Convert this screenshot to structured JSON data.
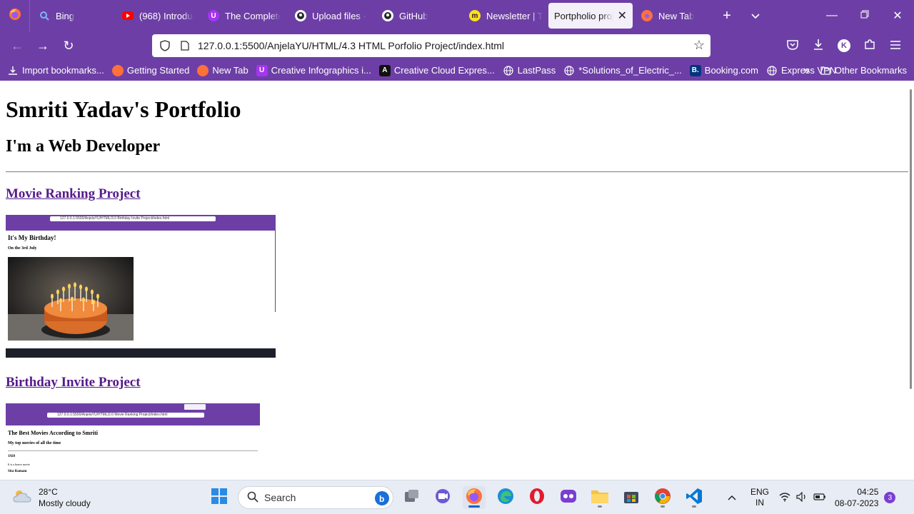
{
  "browser": {
    "tabs": [
      {
        "title": "Bing",
        "icon": "search-icon",
        "color": "#2f7cf6"
      },
      {
        "title": "(968) Introducti",
        "icon": "youtube-icon",
        "color": "#ff0000"
      },
      {
        "title": "The Complete",
        "icon": "udemy-icon",
        "color": "#a435f0"
      },
      {
        "title": "Upload files · S",
        "icon": "github-icon",
        "color": "#24292f"
      },
      {
        "title": "GitHub",
        "icon": "github-icon",
        "color": "#24292f"
      },
      {
        "title": "Newsletter | Th",
        "icon": "chimp-icon",
        "color": "#ffe01b"
      },
      {
        "title": "Portpholio proje",
        "icon": "none",
        "color": "#ffffff"
      },
      {
        "title": "New Tab",
        "icon": "firefox-icon",
        "color": "#ff7139"
      }
    ],
    "active_tab_index": 6,
    "url": "127.0.0.1:5500/AnjelaYU/HTML/4.3 HTML Porfolio Project/index.html",
    "account_initial": "K",
    "bookmarks": [
      {
        "label": "Import bookmarks...",
        "icon": "import-icon"
      },
      {
        "label": "Getting Started",
        "icon": "firefox-icon"
      },
      {
        "label": "New Tab",
        "icon": "firefox-icon"
      },
      {
        "label": "Creative Infographics i...",
        "icon": "udemy-icon"
      },
      {
        "label": "Creative Cloud Expres...",
        "icon": "adobe-icon"
      },
      {
        "label": "LastPass",
        "icon": "globe-icon"
      },
      {
        "label": "*Solutions_of_Electric_...",
        "icon": "globe-icon"
      },
      {
        "label": "Booking.com",
        "icon": "booking-icon"
      },
      {
        "label": "Express VPN",
        "icon": "globe-icon"
      }
    ],
    "other_bookmarks": "Other Bookmarks"
  },
  "page": {
    "title": "Smriti Yadav's Portfolio",
    "subtitle": "I'm a Web Developer",
    "projects": [
      {
        "link": "Movie Ranking Project",
        "preview": {
          "url": "127.0.0.1:5500/AnjelaYU/HTML/3.0 Birthday Invite Project/index.html",
          "heading": "It's My Birthday!",
          "subheading": "On the 3rd July"
        }
      },
      {
        "link": "Birthday Invite Project",
        "preview": {
          "url": "127.0.0.1:5500/AnjelaYU/HTML/2.0 Movie Ranking Project/index.html",
          "heading": "The Best Movies According to Smriti",
          "subheading": "My top movies of all the time",
          "item_year": "1920",
          "item_text": "It is a horror movie",
          "item_name": "Sita Ramam"
        }
      }
    ]
  },
  "taskbar": {
    "weather_temp": "28°C",
    "weather_desc": "Mostly cloudy",
    "search_placeholder": "Search",
    "language_top": "ENG",
    "language_bottom": "IN",
    "time": "04:25",
    "date": "08-07-2023",
    "notification_count": "3"
  }
}
